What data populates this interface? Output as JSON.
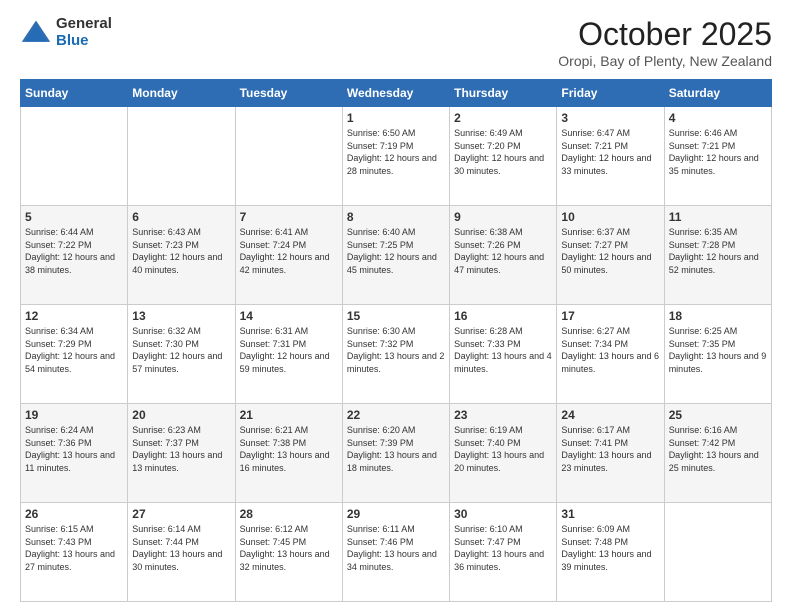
{
  "header": {
    "logo_general": "General",
    "logo_blue": "Blue",
    "month_title": "October 2025",
    "subtitle": "Oropi, Bay of Plenty, New Zealand"
  },
  "weekdays": [
    "Sunday",
    "Monday",
    "Tuesday",
    "Wednesday",
    "Thursday",
    "Friday",
    "Saturday"
  ],
  "weeks": [
    [
      {
        "day": "",
        "sunrise": "",
        "sunset": "",
        "daylight": ""
      },
      {
        "day": "",
        "sunrise": "",
        "sunset": "",
        "daylight": ""
      },
      {
        "day": "",
        "sunrise": "",
        "sunset": "",
        "daylight": ""
      },
      {
        "day": "1",
        "sunrise": "Sunrise: 6:50 AM",
        "sunset": "Sunset: 7:19 PM",
        "daylight": "Daylight: 12 hours and 28 minutes."
      },
      {
        "day": "2",
        "sunrise": "Sunrise: 6:49 AM",
        "sunset": "Sunset: 7:20 PM",
        "daylight": "Daylight: 12 hours and 30 minutes."
      },
      {
        "day": "3",
        "sunrise": "Sunrise: 6:47 AM",
        "sunset": "Sunset: 7:21 PM",
        "daylight": "Daylight: 12 hours and 33 minutes."
      },
      {
        "day": "4",
        "sunrise": "Sunrise: 6:46 AM",
        "sunset": "Sunset: 7:21 PM",
        "daylight": "Daylight: 12 hours and 35 minutes."
      }
    ],
    [
      {
        "day": "5",
        "sunrise": "Sunrise: 6:44 AM",
        "sunset": "Sunset: 7:22 PM",
        "daylight": "Daylight: 12 hours and 38 minutes."
      },
      {
        "day": "6",
        "sunrise": "Sunrise: 6:43 AM",
        "sunset": "Sunset: 7:23 PM",
        "daylight": "Daylight: 12 hours and 40 minutes."
      },
      {
        "day": "7",
        "sunrise": "Sunrise: 6:41 AM",
        "sunset": "Sunset: 7:24 PM",
        "daylight": "Daylight: 12 hours and 42 minutes."
      },
      {
        "day": "8",
        "sunrise": "Sunrise: 6:40 AM",
        "sunset": "Sunset: 7:25 PM",
        "daylight": "Daylight: 12 hours and 45 minutes."
      },
      {
        "day": "9",
        "sunrise": "Sunrise: 6:38 AM",
        "sunset": "Sunset: 7:26 PM",
        "daylight": "Daylight: 12 hours and 47 minutes."
      },
      {
        "day": "10",
        "sunrise": "Sunrise: 6:37 AM",
        "sunset": "Sunset: 7:27 PM",
        "daylight": "Daylight: 12 hours and 50 minutes."
      },
      {
        "day": "11",
        "sunrise": "Sunrise: 6:35 AM",
        "sunset": "Sunset: 7:28 PM",
        "daylight": "Daylight: 12 hours and 52 minutes."
      }
    ],
    [
      {
        "day": "12",
        "sunrise": "Sunrise: 6:34 AM",
        "sunset": "Sunset: 7:29 PM",
        "daylight": "Daylight: 12 hours and 54 minutes."
      },
      {
        "day": "13",
        "sunrise": "Sunrise: 6:32 AM",
        "sunset": "Sunset: 7:30 PM",
        "daylight": "Daylight: 12 hours and 57 minutes."
      },
      {
        "day": "14",
        "sunrise": "Sunrise: 6:31 AM",
        "sunset": "Sunset: 7:31 PM",
        "daylight": "Daylight: 12 hours and 59 minutes."
      },
      {
        "day": "15",
        "sunrise": "Sunrise: 6:30 AM",
        "sunset": "Sunset: 7:32 PM",
        "daylight": "Daylight: 13 hours and 2 minutes."
      },
      {
        "day": "16",
        "sunrise": "Sunrise: 6:28 AM",
        "sunset": "Sunset: 7:33 PM",
        "daylight": "Daylight: 13 hours and 4 minutes."
      },
      {
        "day": "17",
        "sunrise": "Sunrise: 6:27 AM",
        "sunset": "Sunset: 7:34 PM",
        "daylight": "Daylight: 13 hours and 6 minutes."
      },
      {
        "day": "18",
        "sunrise": "Sunrise: 6:25 AM",
        "sunset": "Sunset: 7:35 PM",
        "daylight": "Daylight: 13 hours and 9 minutes."
      }
    ],
    [
      {
        "day": "19",
        "sunrise": "Sunrise: 6:24 AM",
        "sunset": "Sunset: 7:36 PM",
        "daylight": "Daylight: 13 hours and 11 minutes."
      },
      {
        "day": "20",
        "sunrise": "Sunrise: 6:23 AM",
        "sunset": "Sunset: 7:37 PM",
        "daylight": "Daylight: 13 hours and 13 minutes."
      },
      {
        "day": "21",
        "sunrise": "Sunrise: 6:21 AM",
        "sunset": "Sunset: 7:38 PM",
        "daylight": "Daylight: 13 hours and 16 minutes."
      },
      {
        "day": "22",
        "sunrise": "Sunrise: 6:20 AM",
        "sunset": "Sunset: 7:39 PM",
        "daylight": "Daylight: 13 hours and 18 minutes."
      },
      {
        "day": "23",
        "sunrise": "Sunrise: 6:19 AM",
        "sunset": "Sunset: 7:40 PM",
        "daylight": "Daylight: 13 hours and 20 minutes."
      },
      {
        "day": "24",
        "sunrise": "Sunrise: 6:17 AM",
        "sunset": "Sunset: 7:41 PM",
        "daylight": "Daylight: 13 hours and 23 minutes."
      },
      {
        "day": "25",
        "sunrise": "Sunrise: 6:16 AM",
        "sunset": "Sunset: 7:42 PM",
        "daylight": "Daylight: 13 hours and 25 minutes."
      }
    ],
    [
      {
        "day": "26",
        "sunrise": "Sunrise: 6:15 AM",
        "sunset": "Sunset: 7:43 PM",
        "daylight": "Daylight: 13 hours and 27 minutes."
      },
      {
        "day": "27",
        "sunrise": "Sunrise: 6:14 AM",
        "sunset": "Sunset: 7:44 PM",
        "daylight": "Daylight: 13 hours and 30 minutes."
      },
      {
        "day": "28",
        "sunrise": "Sunrise: 6:12 AM",
        "sunset": "Sunset: 7:45 PM",
        "daylight": "Daylight: 13 hours and 32 minutes."
      },
      {
        "day": "29",
        "sunrise": "Sunrise: 6:11 AM",
        "sunset": "Sunset: 7:46 PM",
        "daylight": "Daylight: 13 hours and 34 minutes."
      },
      {
        "day": "30",
        "sunrise": "Sunrise: 6:10 AM",
        "sunset": "Sunset: 7:47 PM",
        "daylight": "Daylight: 13 hours and 36 minutes."
      },
      {
        "day": "31",
        "sunrise": "Sunrise: 6:09 AM",
        "sunset": "Sunset: 7:48 PM",
        "daylight": "Daylight: 13 hours and 39 minutes."
      },
      {
        "day": "",
        "sunrise": "",
        "sunset": "",
        "daylight": ""
      }
    ]
  ]
}
